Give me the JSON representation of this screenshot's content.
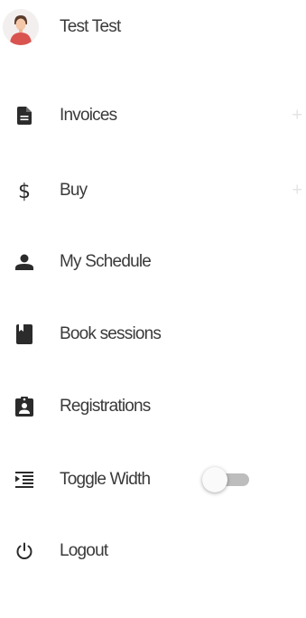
{
  "user": {
    "name": "Test Test"
  },
  "menu": {
    "invoices": {
      "label": "Invoices",
      "icon": "document-icon",
      "expand": "+"
    },
    "buy": {
      "label": "Buy",
      "icon": "dollar-icon",
      "expand": "+"
    },
    "my_schedule": {
      "label": "My Schedule",
      "icon": "person-icon"
    },
    "book_sessions": {
      "label": "Book sessions",
      "icon": "book-icon"
    },
    "registrations": {
      "label": "Registrations",
      "icon": "clipboard-account-icon"
    },
    "toggle_width": {
      "label": "Toggle Width",
      "icon": "format-indent-icon",
      "toggle_on": false
    },
    "logout": {
      "label": "Logout",
      "icon": "power-icon"
    }
  },
  "colors": {
    "text": "#3a3a3a",
    "icon": "#2b2b2b",
    "plus": "#e4e4e4",
    "toggle_track": "#bdbdbd",
    "avatar_red": "#d9534f"
  }
}
